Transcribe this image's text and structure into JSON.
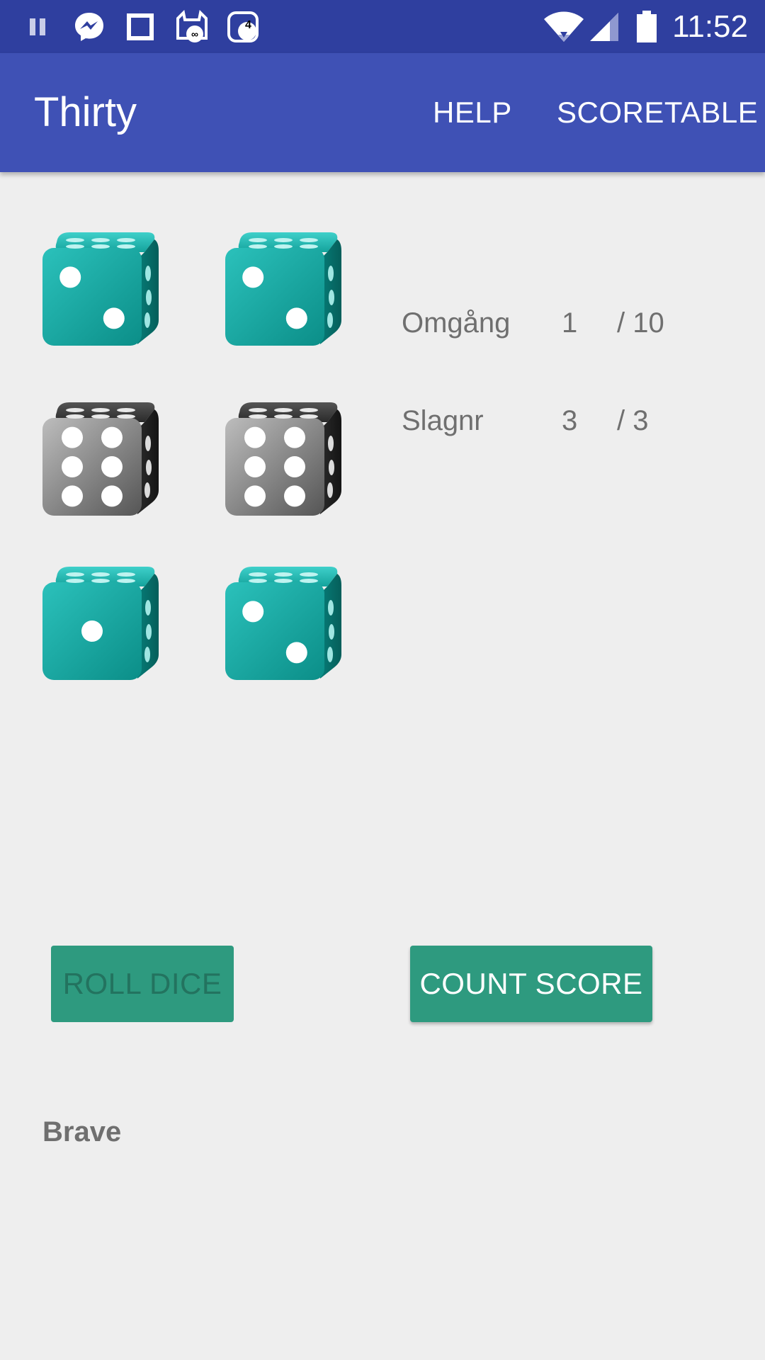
{
  "status_bar": {
    "time": "11:52",
    "notification_badge": "4",
    "icons": [
      "pause-icon",
      "messenger-icon",
      "square-icon",
      "cat-app-icon",
      "notification-count-icon",
      "wifi-icon",
      "cell-signal-icon",
      "battery-icon"
    ]
  },
  "app_bar": {
    "title": "Thirty",
    "help_label": "HELP",
    "scoretable_label": "SCORETABLE",
    "color": "#3f51b5"
  },
  "dice": [
    {
      "value": 2,
      "state": "active",
      "color": "teal"
    },
    {
      "value": 2,
      "state": "active",
      "color": "teal"
    },
    {
      "value": 6,
      "state": "held",
      "color": "gray"
    },
    {
      "value": 6,
      "state": "held",
      "color": "gray"
    },
    {
      "value": 1,
      "state": "active",
      "color": "teal"
    },
    {
      "value": 2,
      "state": "active",
      "color": "teal"
    }
  ],
  "info": {
    "round_label": "Omgång",
    "round_value": "1",
    "round_total": "/ 10",
    "throw_label": "Slagnr",
    "throw_value": "3",
    "throw_total": "/ 3"
  },
  "buttons": {
    "roll_dice": "ROLL DICE",
    "count_score": "COUNT SCORE",
    "accent_color": "#2e9a7f"
  },
  "footer": {
    "text": "Brave"
  }
}
